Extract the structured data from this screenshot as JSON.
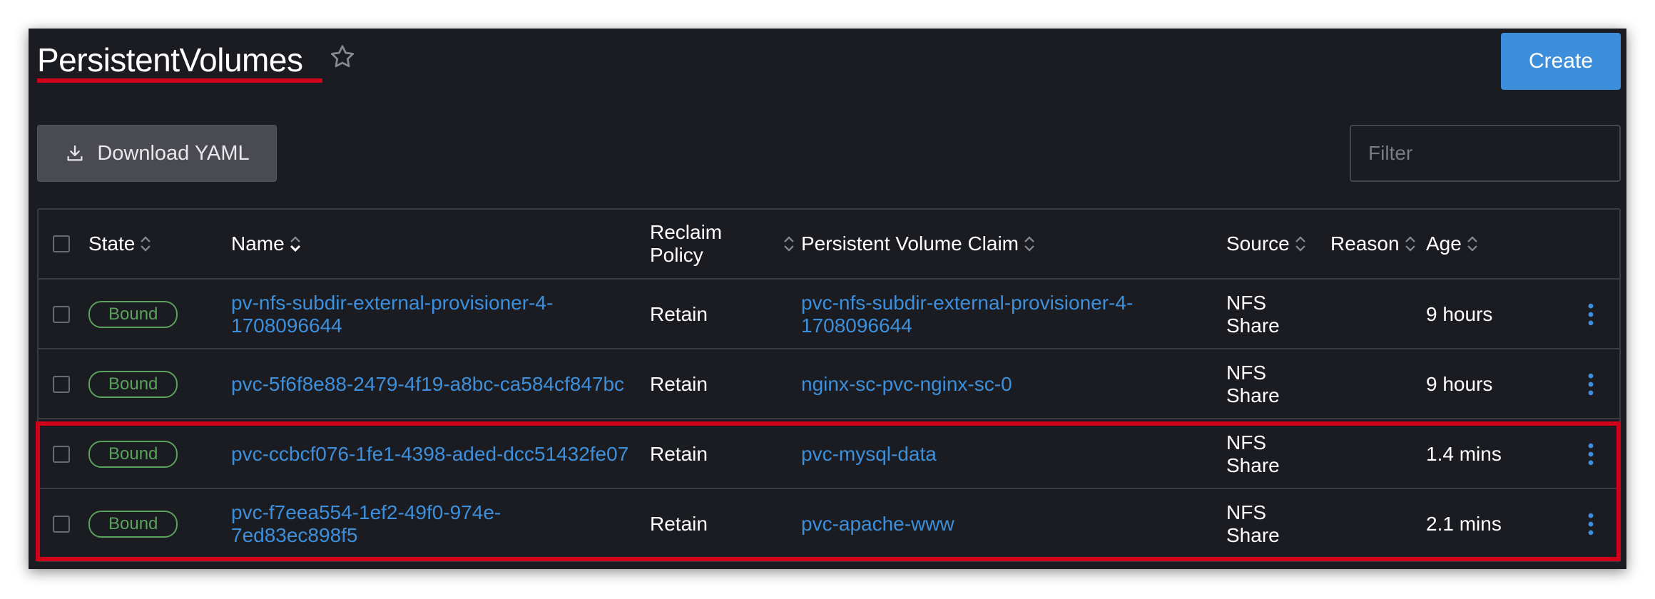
{
  "header": {
    "title": "PersistentVolumes",
    "create_label": "Create"
  },
  "toolbar": {
    "download_label": "Download YAML",
    "filter_placeholder": "Filter"
  },
  "table": {
    "columns": {
      "state": "State",
      "name": "Name",
      "reclaim_policy_line1": "Reclaim",
      "reclaim_policy_line2": "Policy",
      "pvc": "Persistent Volume Claim",
      "source": "Source",
      "reason": "Reason",
      "age": "Age"
    },
    "rows": [
      {
        "state": "Bound",
        "name_line1": "pv-nfs-subdir-external-provisioner-4-",
        "name_line2": "1708096644",
        "reclaim_policy": "Retain",
        "pvc_line1": "pvc-nfs-subdir-external-provisioner-4-",
        "pvc_line2": "1708096644",
        "source_line1": "NFS",
        "source_line2": "Share",
        "reason": "",
        "age": "9 hours"
      },
      {
        "state": "Bound",
        "name_line1": "pvc-5f6f8e88-2479-4f19-a8bc-ca584cf847bc",
        "name_line2": "",
        "reclaim_policy": "Retain",
        "pvc_line1": "nginx-sc-pvc-nginx-sc-0",
        "pvc_line2": "",
        "source_line1": "NFS",
        "source_line2": "Share",
        "reason": "",
        "age": "9 hours"
      },
      {
        "state": "Bound",
        "name_line1": "pvc-ccbcf076-1fe1-4398-aded-dcc51432fe07",
        "name_line2": "",
        "reclaim_policy": "Retain",
        "pvc_line1": "pvc-mysql-data",
        "pvc_line2": "",
        "source_line1": "NFS",
        "source_line2": "Share",
        "reason": "",
        "age": "1.4 mins"
      },
      {
        "state": "Bound",
        "name_line1": "pvc-f7eea554-1ef2-49f0-974e-",
        "name_line2": "7ed83ec898f5",
        "reclaim_policy": "Retain",
        "pvc_line1": "pvc-apache-www",
        "pvc_line2": "",
        "source_line1": "NFS",
        "source_line2": "Share",
        "reason": "",
        "age": "2.1 mins"
      }
    ]
  },
  "icons": {
    "favorite": "star-outline-icon",
    "download": "download-icon",
    "sort": "sort-icon",
    "row_actions": "kebab-menu-icon"
  },
  "colors": {
    "background": "#1b1c21",
    "accent": "#3d8fdb",
    "badge_green": "#5aa25c",
    "highlight_red": "#d0021b"
  }
}
